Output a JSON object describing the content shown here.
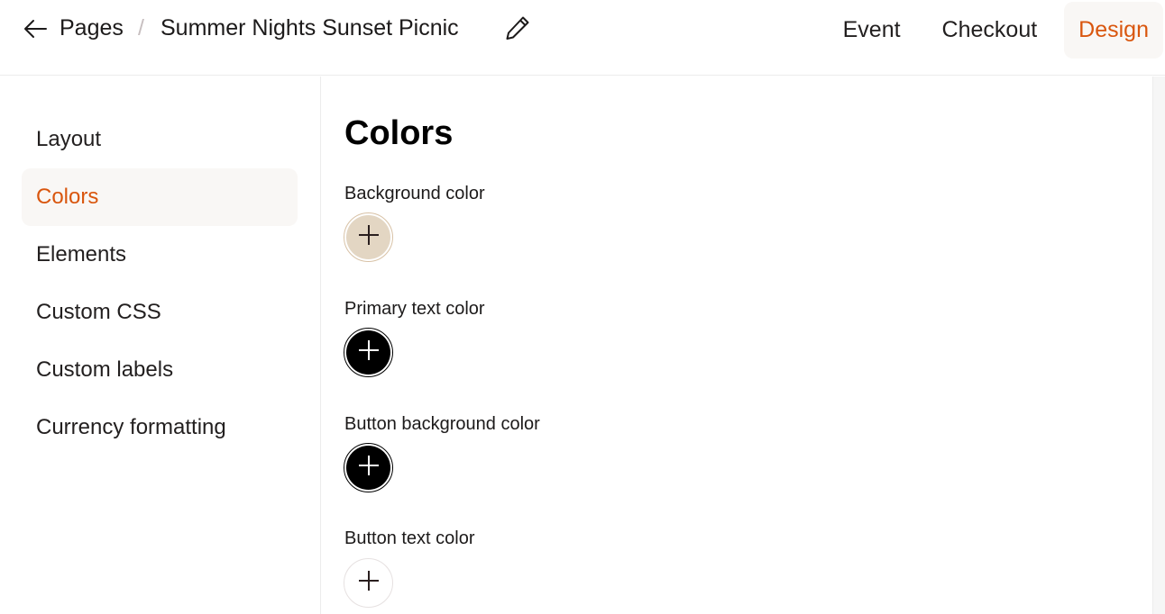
{
  "header": {
    "back_icon": "arrow-left-icon",
    "breadcrumb_root": "Pages",
    "breadcrumb_separator": "/",
    "page_title": "Summer Nights Sunset Picnic",
    "edit_icon": "pencil-icon"
  },
  "nav": {
    "tabs": [
      {
        "label": "Event",
        "active": false
      },
      {
        "label": "Checkout",
        "active": false
      },
      {
        "label": "Design",
        "active": true
      }
    ]
  },
  "sidebar": {
    "items": [
      {
        "label": "Layout",
        "active": false
      },
      {
        "label": "Colors",
        "active": true
      },
      {
        "label": "Elements",
        "active": false
      },
      {
        "label": "Custom CSS",
        "active": false
      },
      {
        "label": "Custom labels",
        "active": false
      },
      {
        "label": "Currency formatting",
        "active": false
      }
    ]
  },
  "main": {
    "heading": "Colors",
    "fields": [
      {
        "label": "Background color",
        "color": "#e3d6c3",
        "ring": "#d8c2a6",
        "icon_color": "#2a1f1f"
      },
      {
        "label": "Primary text color",
        "color": "#000000",
        "ring": "#000000",
        "icon_color": "#ffffff"
      },
      {
        "label": "Button background color",
        "color": "#000000",
        "ring": "#000000",
        "icon_color": "#ffffff"
      },
      {
        "label": "Button text color",
        "color": "#ffffff",
        "ring": "#e6e1e1",
        "icon_color": "#2a1f1f"
      }
    ]
  },
  "theme": {
    "accent": "#d9560e",
    "active_bg": "#f9f7f5",
    "border": "#ececec"
  }
}
